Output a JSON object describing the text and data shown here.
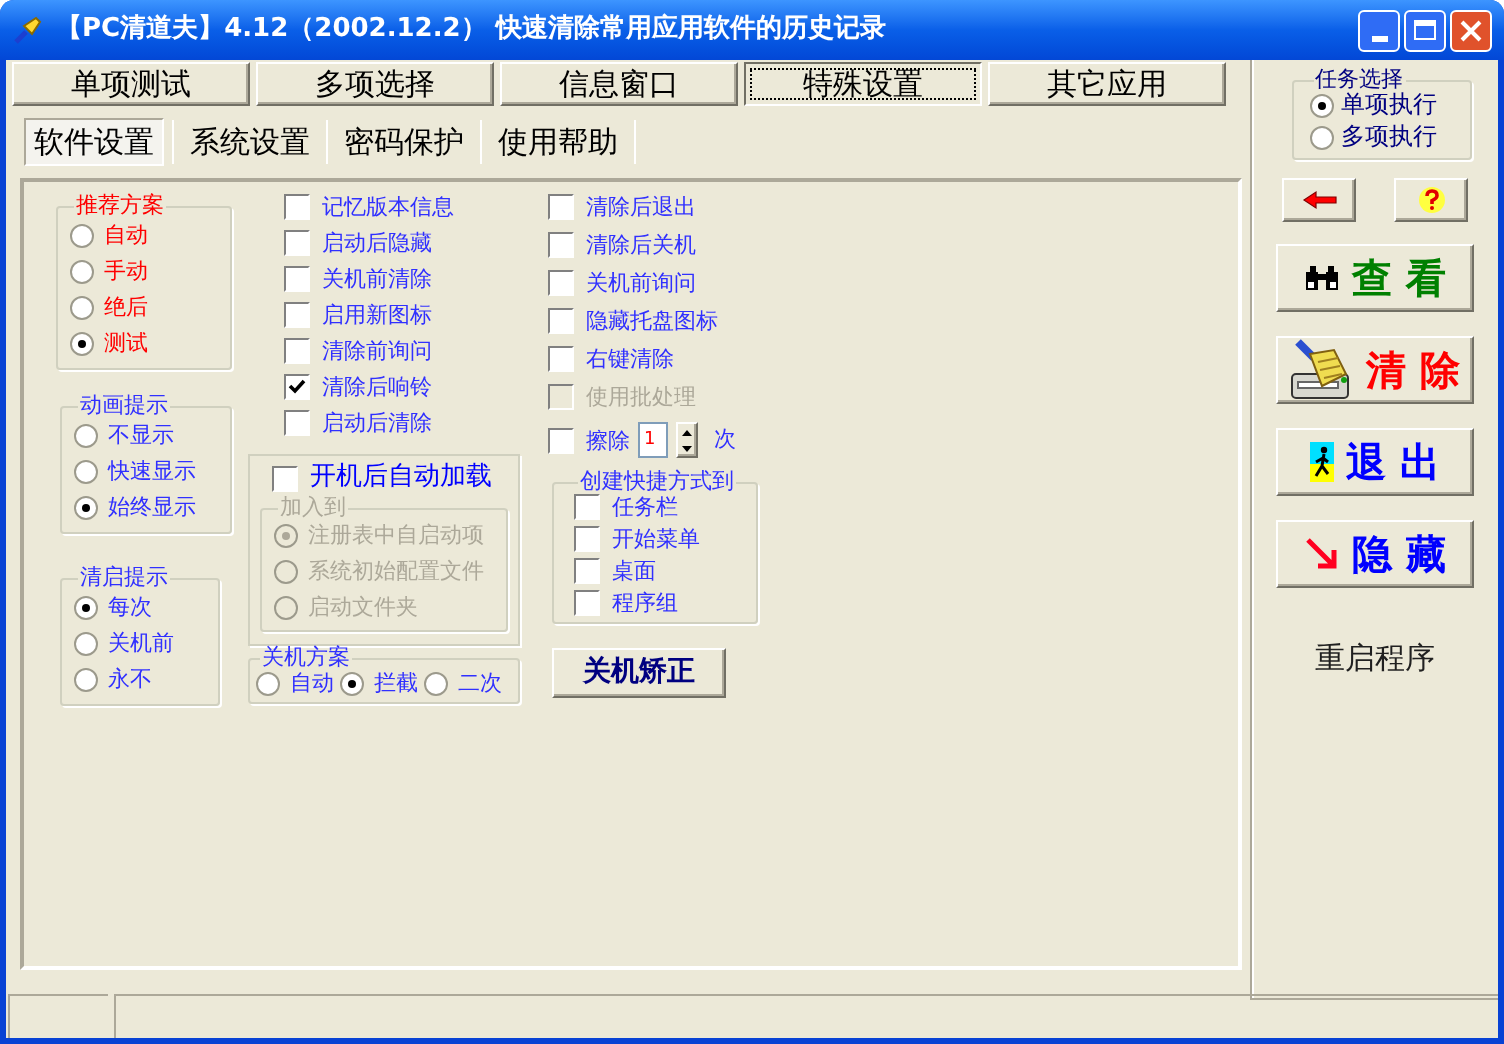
{
  "window": {
    "title": "【PC清道夫】4.12（2002.12.2） 快速清除常用应用软件的历史记录"
  },
  "main_tabs": [
    {
      "label": "单项测试",
      "selected": false
    },
    {
      "label": "多项选择",
      "selected": false
    },
    {
      "label": "信息窗口",
      "selected": false
    },
    {
      "label": "特殊设置",
      "selected": true
    },
    {
      "label": "其它应用",
      "selected": false
    }
  ],
  "sub_tabs": [
    {
      "label": "软件设置",
      "selected": true
    },
    {
      "label": "系统设置",
      "selected": false
    },
    {
      "label": "密码保护",
      "selected": false
    },
    {
      "label": "使用帮助",
      "selected": false
    }
  ],
  "recommend": {
    "title": "推荐方案",
    "options": [
      {
        "label": "自动",
        "selected": false
      },
      {
        "label": "手动",
        "selected": false
      },
      {
        "label": "绝后",
        "selected": false
      },
      {
        "label": "测试",
        "selected": true
      }
    ]
  },
  "animation": {
    "title": "动画提示",
    "options": [
      {
        "label": "不显示",
        "selected": false
      },
      {
        "label": "快速显示",
        "selected": false
      },
      {
        "label": "始终显示",
        "selected": true
      }
    ]
  },
  "clear_prompt": {
    "title": "清启提示",
    "options": [
      {
        "label": "每次",
        "selected": true
      },
      {
        "label": "关机前",
        "selected": false
      },
      {
        "label": "永不",
        "selected": false
      }
    ]
  },
  "options_a": [
    {
      "label": "记忆版本信息",
      "checked": false
    },
    {
      "label": "启动后隐藏",
      "checked": false
    },
    {
      "label": "关机前清除",
      "checked": false
    },
    {
      "label": "启用新图标",
      "checked": false
    },
    {
      "label": "清除前询问",
      "checked": false
    },
    {
      "label": "清除后响铃",
      "checked": true
    },
    {
      "label": "启动后清除",
      "checked": false
    }
  ],
  "autoload": {
    "label": "开机后自动加载",
    "checked": false,
    "add_to": {
      "title": "加入到",
      "disabled": true,
      "options": [
        {
          "label": "注册表中自启动项",
          "selected": true
        },
        {
          "label": "系统初始配置文件",
          "selected": false
        },
        {
          "label": "启动文件夹",
          "selected": false
        }
      ]
    }
  },
  "shutdown_plan": {
    "title": "关机方案",
    "options": [
      {
        "label": "自动",
        "selected": false
      },
      {
        "label": "拦截",
        "selected": true
      },
      {
        "label": "二次",
        "selected": false
      }
    ]
  },
  "options_b": [
    {
      "label": "清除后退出",
      "checked": false,
      "disabled": false
    },
    {
      "label": "清除后关机",
      "checked": false,
      "disabled": false
    },
    {
      "label": "关机前询问",
      "checked": false,
      "disabled": false
    },
    {
      "label": "隐藏托盘图标",
      "checked": false,
      "disabled": false
    },
    {
      "label": "右键清除",
      "checked": false,
      "disabled": false
    },
    {
      "label": "使用批处理",
      "checked": false,
      "disabled": true
    }
  ],
  "erase": {
    "label": "擦除",
    "checked": false,
    "value": "1",
    "unit": "次"
  },
  "shortcut": {
    "title": "创建快捷方式到",
    "options": [
      {
        "label": "任务栏",
        "checked": false
      },
      {
        "label": "开始菜单",
        "checked": false
      },
      {
        "label": "桌面",
        "checked": false
      },
      {
        "label": "程序组",
        "checked": false
      }
    ]
  },
  "correct_button": "关机矫正",
  "task_select": {
    "title": "任务选择",
    "options": [
      {
        "label": "单项执行",
        "selected": true
      },
      {
        "label": "多项执行",
        "selected": false
      }
    ]
  },
  "small_buttons": [
    {
      "kind": "back"
    },
    {
      "kind": "help"
    }
  ],
  "actions": [
    {
      "label": "查 看",
      "kind": "view"
    },
    {
      "label": "清 除",
      "kind": "clear"
    },
    {
      "label": "退 出",
      "kind": "exit"
    },
    {
      "label": "隐 藏",
      "kind": "hide"
    }
  ],
  "restart": "重启程序"
}
